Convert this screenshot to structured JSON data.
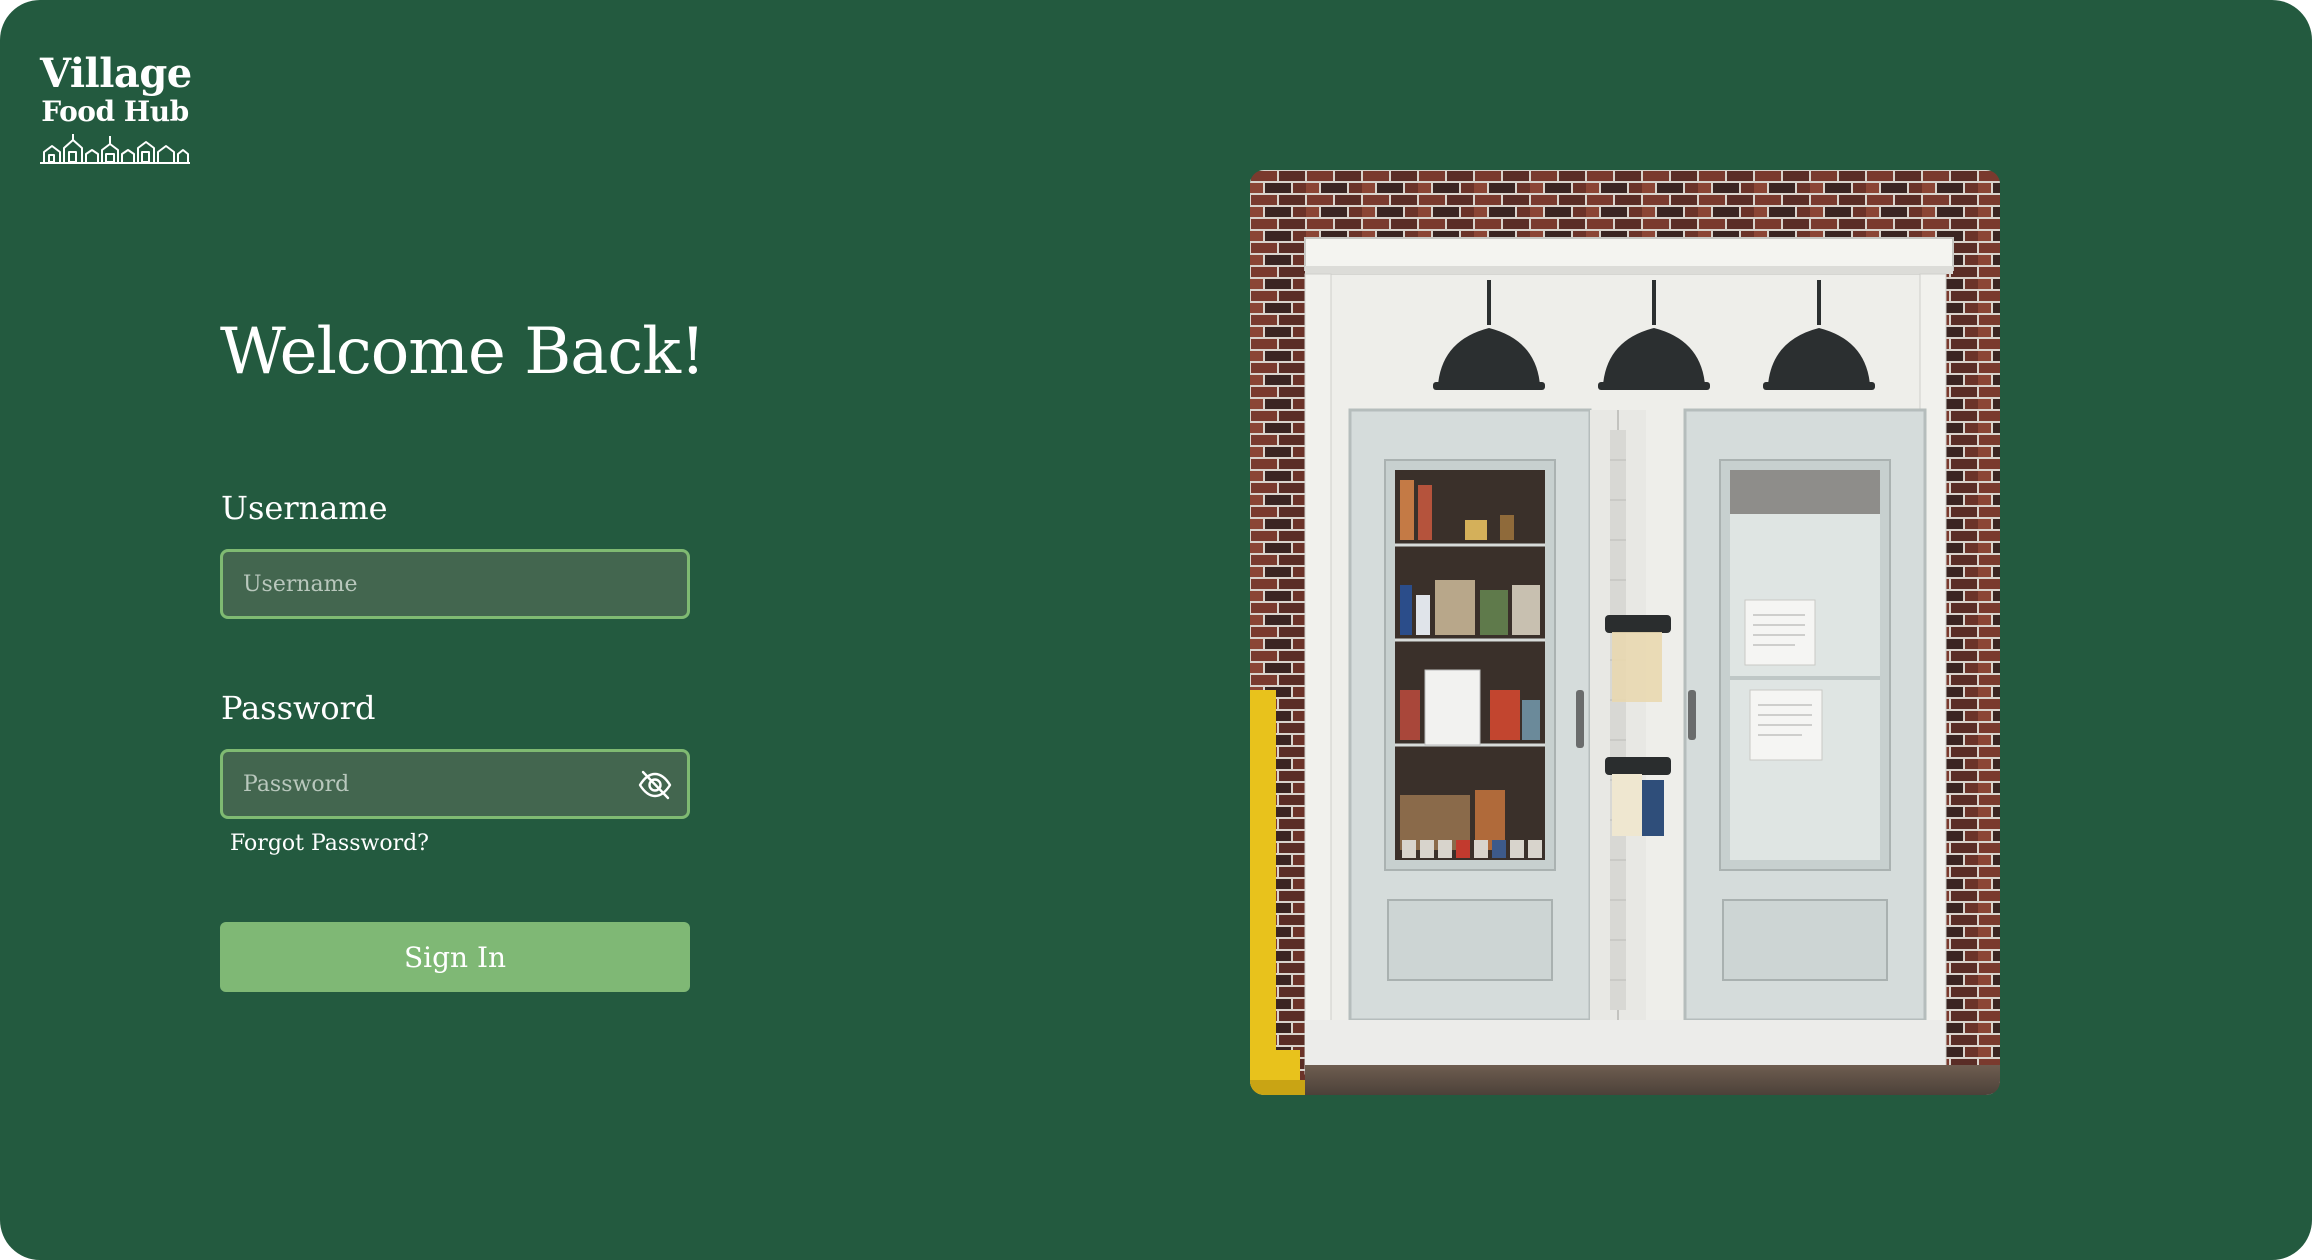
{
  "brand": {
    "name_line1": "Village",
    "name_line2": "Food Hub",
    "logo_icon": "village-houses-icon"
  },
  "login": {
    "heading": "Welcome Back!",
    "username": {
      "label": "Username",
      "placeholder": "Username",
      "value": ""
    },
    "password": {
      "label": "Password",
      "placeholder": "Password",
      "value": "",
      "toggle_icon": "eye-off-icon"
    },
    "forgot_password": "Forgot Password?",
    "submit": "Sign In"
  },
  "photo": {
    "subject": "community-food-pantry-doors"
  },
  "colors": {
    "background": "#235a3f",
    "accent": "#7fb875",
    "input_fill": "#43664f",
    "input_border": "#7fba72",
    "text": "#ffffff"
  }
}
